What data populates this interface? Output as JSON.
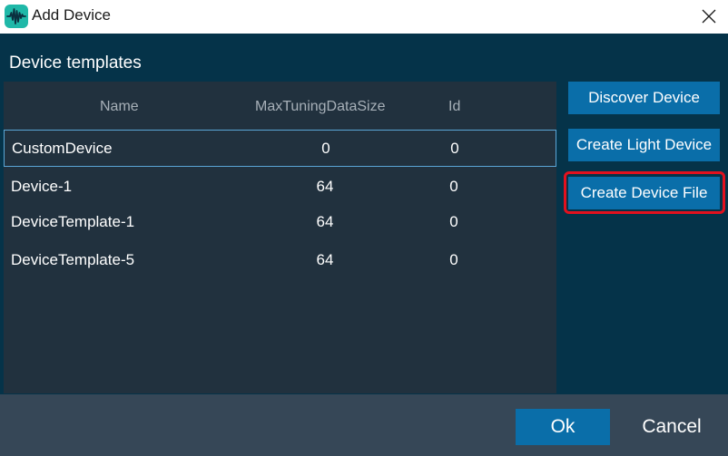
{
  "window": {
    "title": "Add Device",
    "app_icon": "waveform-icon",
    "close_icon": "close-icon"
  },
  "section": {
    "title": "Device templates"
  },
  "table": {
    "columns": [
      "Name",
      "MaxTuningDataSize",
      "Id"
    ],
    "rows": [
      {
        "name": "CustomDevice",
        "max": "0",
        "id": "0",
        "selected": true
      },
      {
        "name": "Device-1",
        "max": "64",
        "id": "0",
        "selected": false
      },
      {
        "name": "DeviceTemplate-1",
        "max": "64",
        "id": "0",
        "selected": false
      },
      {
        "name": "DeviceTemplate-5",
        "max": "64",
        "id": "0",
        "selected": false
      }
    ]
  },
  "actions": {
    "discover": "Discover Device",
    "create_light": "Create Light Device",
    "create_file": "Create Device File"
  },
  "footer": {
    "ok": "Ok",
    "cancel": "Cancel"
  },
  "colors": {
    "background": "#053349",
    "panel": "#21313e",
    "footer": "#364757",
    "button": "#0a6ea9",
    "highlight": "#e2111e",
    "selection_border": "#5aa6d6",
    "app_icon": "#1fb8a8"
  }
}
